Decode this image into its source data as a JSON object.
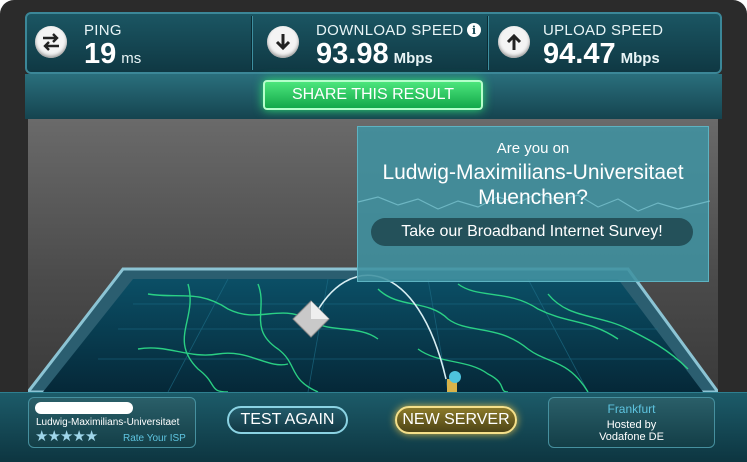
{
  "header": {
    "ping": {
      "label": "PING",
      "value": "19",
      "unit": "ms"
    },
    "download": {
      "label": "DOWNLOAD SPEED",
      "value": "93.98",
      "unit": "Mbps"
    },
    "upload": {
      "label": "UPLOAD SPEED",
      "value": "94.47",
      "unit": "Mbps"
    },
    "icons": {
      "ping": "ping-arrows-icon",
      "download": "download-arrow-icon",
      "upload": "upload-arrow-icon",
      "info": "info-icon"
    }
  },
  "share_button": "SHARE THIS RESULT",
  "survey": {
    "question_line1": "Are you on",
    "question_line2": "Ludwig-Maximilians-Universitaet",
    "question_line3": "Muenchen?",
    "button": "Take our Broadband Internet Survey!"
  },
  "isp": {
    "name": "Ludwig-Maximilians-Universitaet",
    "rating_link": "Rate Your ISP",
    "stars": 5
  },
  "buttons": {
    "test_again": "TEST AGAIN",
    "new_server": "NEW SERVER"
  },
  "server": {
    "city": "Frankfurt",
    "hosted_by_label": "Hosted by",
    "host": "Vodafone DE"
  },
  "colors": {
    "accent_green": "#2fe070",
    "teal": "#3b8798",
    "gold": "#f5e08a"
  }
}
